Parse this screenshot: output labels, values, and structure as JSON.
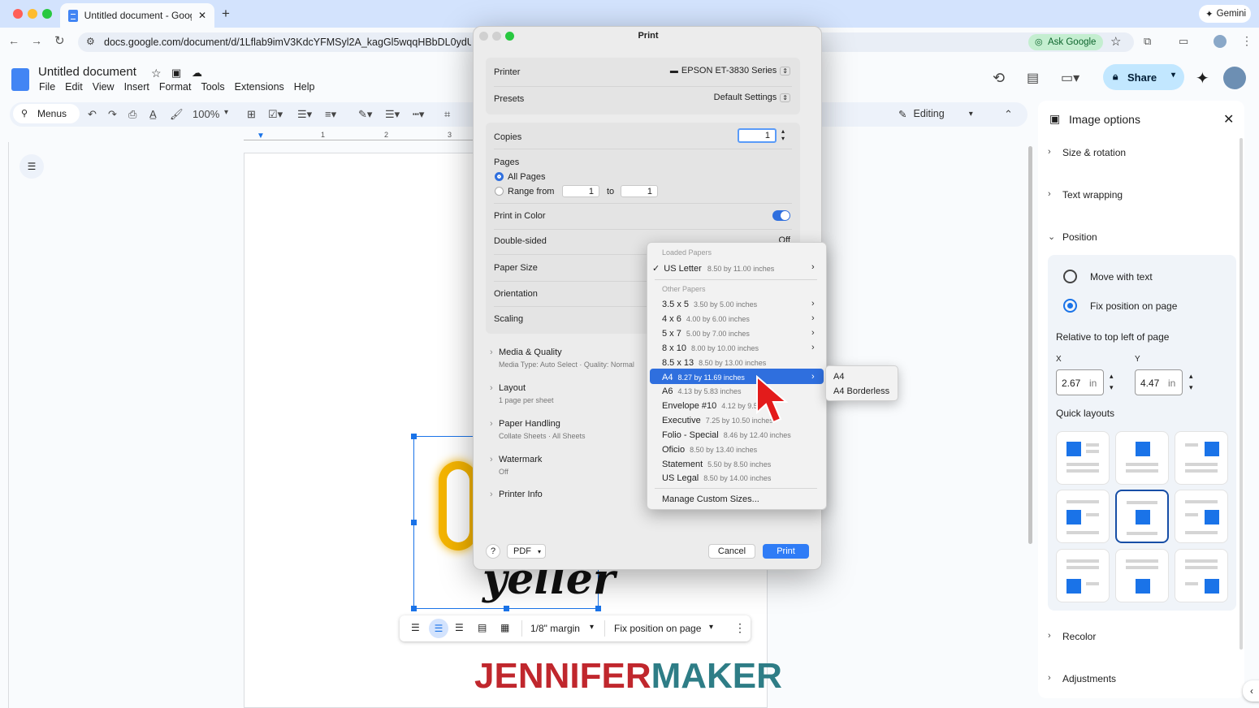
{
  "browser": {
    "tab_title": "Untitled document - Google D",
    "new_tab": "+",
    "url": "docs.google.com/document/d/1Lflab9imV3KdcYFMSyl2A_kagGl5wqqHBbDL0ydUvSw",
    "ask_google": "Ask Google",
    "gemini": "Gemini"
  },
  "docs": {
    "title": "Untitled document",
    "menu": [
      "File",
      "Edit",
      "View",
      "Insert",
      "Format",
      "Tools",
      "Extensions",
      "Help"
    ],
    "menus_search": "Menus",
    "zoom": "100%",
    "editing": "Editing",
    "share": "Share",
    "ruler_ticks": [
      "1",
      "2",
      "3"
    ]
  },
  "print_dialog": {
    "title": "Print",
    "printer_label": "Printer",
    "printer_value": "EPSON ET-3830 Series",
    "presets_label": "Presets",
    "presets_value": "Default Settings",
    "copies_label": "Copies",
    "copies_value": "1",
    "pages_label": "Pages",
    "all_pages": "All Pages",
    "range_from": "Range from",
    "range_start": "1",
    "range_to": "to",
    "range_end": "1",
    "print_in_color": "Print in Color",
    "double_sided": "Double-sided",
    "double_sided_value": "Off",
    "paper_size": "Paper Size",
    "orientation": "Orientation",
    "scaling": "Scaling",
    "sections": [
      {
        "title": "Media & Quality",
        "sub": "Media Type: Auto Select · Quality: Normal"
      },
      {
        "title": "Layout",
        "sub": "1 page per sheet"
      },
      {
        "title": "Paper Handling",
        "sub": "Collate Sheets · All Sheets"
      },
      {
        "title": "Watermark",
        "sub": "Off"
      },
      {
        "title": "Printer Info",
        "sub": ""
      }
    ],
    "help": "?",
    "pdf": "PDF",
    "cancel": "Cancel",
    "print": "Print"
  },
  "paper_menu": {
    "loaded_header": "Loaded Papers",
    "loaded": [
      {
        "name": "US Letter",
        "size": "8.50 by 11.00 inches",
        "checked": true
      }
    ],
    "other_header": "Other Papers",
    "other": [
      {
        "name": "3.5 x 5",
        "size": "3.50 by 5.00 inches"
      },
      {
        "name": "4 x 6",
        "size": "4.00 by 6.00 inches"
      },
      {
        "name": "5 x 7",
        "size": "5.00 by 7.00 inches"
      },
      {
        "name": "8 x 10",
        "size": "8.00 by 10.00 inches"
      },
      {
        "name": "8.5 x 13",
        "size": "8.50 by 13.00 inches"
      },
      {
        "name": "A4",
        "size": "8.27 by 11.69 inches"
      },
      {
        "name": "A6",
        "size": "4.13 by 5.83 inches"
      },
      {
        "name": "Envelope #10",
        "size": "4.12 by 9.5"
      },
      {
        "name": "Executive",
        "size": "7.25 by 10.50 inches"
      },
      {
        "name": "Folio - Special",
        "size": "8.46 by 12.40 inches"
      },
      {
        "name": "Oficio",
        "size": "8.50 by 13.40 inches"
      },
      {
        "name": "Statement",
        "size": "5.50 by 8.50 inches"
      },
      {
        "name": "US Legal",
        "size": "8.50 by 14.00 inches"
      }
    ],
    "manage": "Manage Custom Sizes...",
    "submenu": [
      "A4",
      "A4 Borderless"
    ]
  },
  "image_options": {
    "title": "Image options",
    "size_rotation": "Size & rotation",
    "text_wrapping": "Text wrapping",
    "position": "Position",
    "move_with_text": "Move with text",
    "fix_position": "Fix position on page",
    "relative": "Relative to top left of page",
    "x_label": "X",
    "x_value": "2.67",
    "y_label": "Y",
    "y_value": "4.47",
    "unit": "in",
    "quick_layouts": "Quick layouts",
    "recolor": "Recolor",
    "adjustments": "Adjustments"
  },
  "image_toolbar": {
    "margin": "1/8\" margin",
    "position": "Fix position on page"
  },
  "watermark_logo": {
    "part1": "JENNIFER",
    "part2": "MAKER",
    "color1": "#c0272d",
    "color2": "#2e7d86"
  }
}
